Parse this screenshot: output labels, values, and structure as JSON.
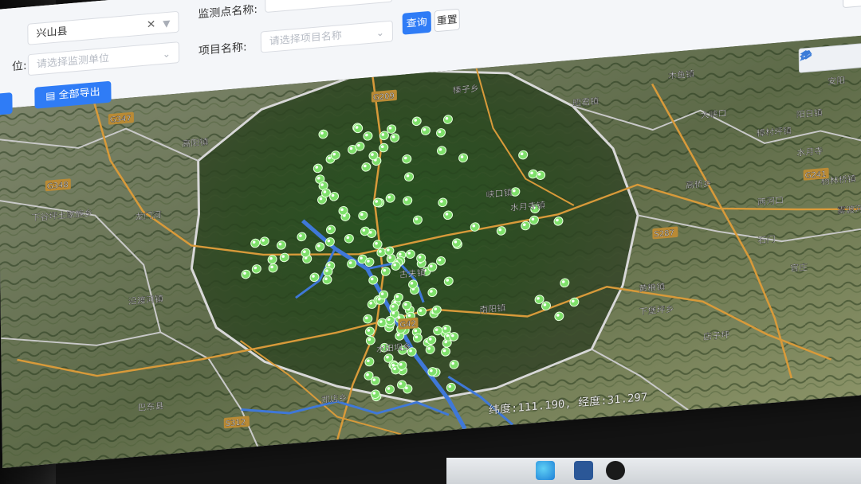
{
  "filters": {
    "county_value": "兴山县",
    "row1_field2_label": "监测点名称:",
    "unit_label_fragment": "位:",
    "unit_placeholder": "请选择监测单位",
    "project_label": "项目名称:",
    "project_placeholder": "请选择项目名称",
    "query_button": "查询",
    "reset_button": "重置"
  },
  "toolbar": {
    "export_all_button": "全部导出",
    "view_buttons": [
      "list-view-icon",
      "map-view-icon"
    ],
    "active_view": "map-view-icon"
  },
  "map": {
    "tools": [
      "layers-icon",
      "draw-icon",
      "measure-icon"
    ],
    "place_labels": [
      "昭君镇",
      "水月寺镇",
      "峡口镇",
      "高桥乡",
      "古夫镇",
      "南阳镇",
      "黄粮镇",
      "榛子乡",
      "高阳镇",
      "龙门河",
      "下谷坪土家族乡",
      "巴东县",
      "水田坝乡",
      "郑店乡",
      "木鱼镇",
      "大峡口",
      "水月寺",
      "杨林桥镇",
      "雾渡河镇",
      "石门",
      "两河口",
      "店子坪",
      "下堡坪乡",
      "官庄",
      "樟村坪镇",
      "阳日镇",
      "安阳",
      "沿渡河镇"
    ],
    "road_labels": [
      "G347",
      "G209",
      "G241",
      "G42",
      "S287",
      "S312",
      "G348"
    ],
    "coordinates": "纬度:111.190, 经度:31.297",
    "marker_count_visible": 160,
    "colors": {
      "marker": "#7fe06b",
      "river": "#3f78d8",
      "boundary": "#c9c9c9",
      "road": "#d89a3a",
      "terrain_dark": "#2d4a22",
      "terrain_light": "#8c9468"
    }
  },
  "taskbar": {
    "icons": [
      "edge-icon",
      "word-icon",
      "dell-icon"
    ]
  }
}
